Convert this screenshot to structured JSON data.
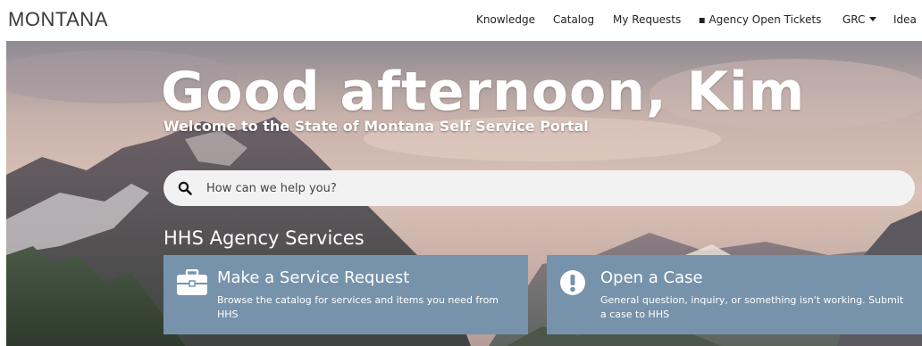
{
  "header": {
    "logo": "MONTANA",
    "nav": {
      "knowledge": "Knowledge",
      "catalog": "Catalog",
      "my_requests": "My Requests",
      "agency_open_tickets": "Agency Open Tickets",
      "grc": "GRC",
      "idea": "Idea"
    }
  },
  "hero": {
    "greeting": "Good afternoon, Kim",
    "subtitle": "Welcome to the State of Montana Self Service Portal",
    "search_placeholder": "How can we help you?",
    "section_title": "HHS Agency Services",
    "cards": [
      {
        "title": "Make a Service Request",
        "description": "Browse the catalog for services and items you need from HHS",
        "icon": "briefcase-icon"
      },
      {
        "title": "Open a Case",
        "description": "General question, inquiry, or something isn't working. Submit a case to HHS",
        "icon": "exclamation-circle-icon"
      }
    ]
  },
  "colors": {
    "card_background": "#7793ab",
    "search_background": "#f2f2f2",
    "text_on_hero": "#ffffff"
  }
}
